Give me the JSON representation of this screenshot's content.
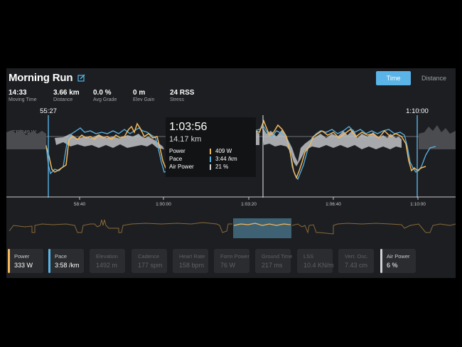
{
  "activity": {
    "title": "Morning Run",
    "edit_icon": "edit-icon"
  },
  "toggle": {
    "time": "Time",
    "distance": "Distance",
    "active": "Time"
  },
  "stats": [
    {
      "value": "14:33",
      "label": "Moving Time"
    },
    {
      "value": "3.66 km",
      "label": "Distance"
    },
    {
      "value": "0.0 %",
      "label": "Avg Grade"
    },
    {
      "value": "0 m",
      "label": "Elev Gain"
    },
    {
      "value": "24 RSS",
      "label": "Stress"
    }
  ],
  "chart": {
    "cp_label": "CP 349 W",
    "range_start": "55:27",
    "range_end": "1:10:00",
    "x_ticks": [
      "58:40",
      "1:00:00",
      "1:03:20",
      "1:06:40",
      "1:10:00"
    ]
  },
  "tooltip": {
    "time": "1:03:56",
    "distance": "14.17 km",
    "rows": [
      {
        "label": "Power",
        "value": "409 W",
        "color": "#f5b85a"
      },
      {
        "label": "Pace",
        "value": "3:44 /km",
        "color": "#5ab4e8"
      },
      {
        "label": "Air Power",
        "value": "21 %",
        "color": "#d0d2d4"
      }
    ]
  },
  "metrics": [
    {
      "label": "Power",
      "value": "333 W",
      "active": true,
      "color": "#f5b85a"
    },
    {
      "label": "Pace",
      "value": "3:58 /km",
      "active": true,
      "color": "#5ab4e8"
    },
    {
      "label": "Elevation",
      "value": "1492 m",
      "active": false
    },
    {
      "label": "Cadence",
      "value": "177 spm",
      "active": false
    },
    {
      "label": "Heart Rate",
      "value": "158 bpm",
      "active": false
    },
    {
      "label": "Form Power",
      "value": "76 W",
      "active": false
    },
    {
      "label": "Ground Time",
      "value": "217 ms",
      "active": false
    },
    {
      "label": "LSS",
      "value": "10.4 KN/m",
      "active": false
    },
    {
      "label": "Vert. Osc.",
      "value": "7.43 cm",
      "active": false
    },
    {
      "label": "Air Power",
      "value": "6 %",
      "active": true,
      "color": "#d0d2d4"
    }
  ],
  "colors": {
    "power": "#f5b85a",
    "pace": "#5ab4e8",
    "air_power": "#d0d2d4",
    "panel": "#1c1e21"
  }
}
